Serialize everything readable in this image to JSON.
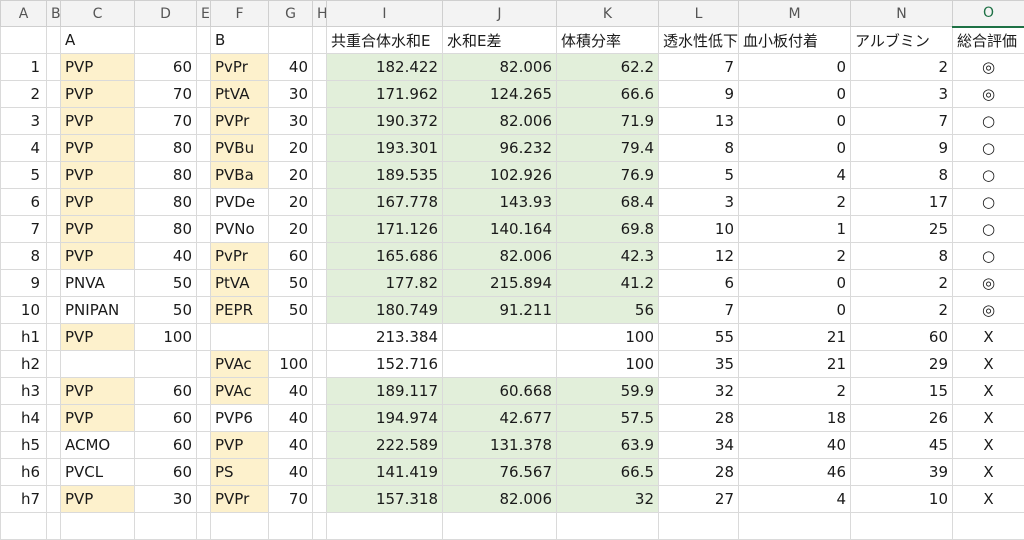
{
  "columns": [
    "A",
    "B",
    "C",
    "D",
    "E",
    "F",
    "G",
    "H",
    "I",
    "J",
    "K",
    "L",
    "M",
    "N",
    "O"
  ],
  "header": {
    "c": "A",
    "f": "B",
    "i": "共重合体水和E",
    "j": "水和E差",
    "k": "体積分率",
    "l": "透水性低下",
    "m": "血小板付着",
    "n": "アルブミン",
    "o": "総合評価"
  },
  "rows": [
    {
      "a": "1",
      "c": "PVP",
      "cy": true,
      "d": "60",
      "f": "PvPr",
      "fy": true,
      "g": "40",
      "i": "182.422",
      "j": "82.006",
      "k": "62.2",
      "gr": true,
      "l": "7",
      "m": "0",
      "n": "2",
      "o": "◎"
    },
    {
      "a": "2",
      "c": "PVP",
      "cy": true,
      "d": "70",
      "f": "PtVA",
      "fy": true,
      "g": "30",
      "i": "171.962",
      "j": "124.265",
      "k": "66.6",
      "gr": true,
      "l": "9",
      "m": "0",
      "n": "3",
      "o": "◎"
    },
    {
      "a": "3",
      "c": "PVP",
      "cy": true,
      "d": "70",
      "f": "PVPr",
      "fy": true,
      "g": "30",
      "i": "190.372",
      "j": "82.006",
      "k": "71.9",
      "gr": true,
      "l": "13",
      "m": "0",
      "n": "7",
      "o": "○"
    },
    {
      "a": "4",
      "c": "PVP",
      "cy": true,
      "d": "80",
      "f": "PVBu",
      "fy": true,
      "g": "20",
      "i": "193.301",
      "j": "96.232",
      "k": "79.4",
      "gr": true,
      "l": "8",
      "m": "0",
      "n": "9",
      "o": "○"
    },
    {
      "a": "5",
      "c": "PVP",
      "cy": true,
      "d": "80",
      "f": "PVBa",
      "fy": true,
      "g": "20",
      "i": "189.535",
      "j": "102.926",
      "k": "76.9",
      "gr": true,
      "l": "5",
      "m": "4",
      "n": "8",
      "o": "○"
    },
    {
      "a": "6",
      "c": "PVP",
      "cy": true,
      "d": "80",
      "f": "PVDe",
      "fy": false,
      "g": "20",
      "i": "167.778",
      "j": "143.93",
      "k": "68.4",
      "gr": true,
      "l": "3",
      "m": "2",
      "n": "17",
      "o": "○"
    },
    {
      "a": "7",
      "c": "PVP",
      "cy": true,
      "d": "80",
      "f": "PVNo",
      "fy": false,
      "g": "20",
      "i": "171.126",
      "j": "140.164",
      "k": "69.8",
      "gr": true,
      "l": "10",
      "m": "1",
      "n": "25",
      "o": "○"
    },
    {
      "a": "8",
      "c": "PVP",
      "cy": true,
      "d": "40",
      "f": "PvPr",
      "fy": true,
      "g": "60",
      "i": "165.686",
      "j": "82.006",
      "k": "42.3",
      "gr": true,
      "l": "12",
      "m": "2",
      "n": "8",
      "o": "○"
    },
    {
      "a": "9",
      "c": "PNVA",
      "cy": false,
      "d": "50",
      "f": "PtVA",
      "fy": true,
      "g": "50",
      "i": "177.82",
      "j": "215.894",
      "k": "41.2",
      "gr": true,
      "l": "6",
      "m": "0",
      "n": "2",
      "o": "◎"
    },
    {
      "a": "10",
      "c": "PNIPAN",
      "cy": false,
      "d": "50",
      "f": "PEPR",
      "fy": true,
      "g": "50",
      "i": "180.749",
      "j": "91.211",
      "k": "56",
      "gr": true,
      "l": "7",
      "m": "0",
      "n": "2",
      "o": "◎"
    },
    {
      "a": "h1",
      "c": "PVP",
      "cy": true,
      "d": "100",
      "f": "",
      "fy": false,
      "g": "",
      "i": "213.384",
      "j": "",
      "k": "100",
      "gr": false,
      "l": "55",
      "m": "21",
      "n": "60",
      "o": "X"
    },
    {
      "a": "h2",
      "c": "",
      "cy": false,
      "d": "",
      "f": "PVAc",
      "fy": true,
      "g": "100",
      "i": "152.716",
      "j": "",
      "k": "100",
      "gr": false,
      "l": "35",
      "m": "21",
      "n": "29",
      "o": "X"
    },
    {
      "a": "h3",
      "c": "PVP",
      "cy": true,
      "d": "60",
      "f": "PVAc",
      "fy": true,
      "g": "40",
      "i": "189.117",
      "j": "60.668",
      "k": "59.9",
      "gr": true,
      "l": "32",
      "m": "2",
      "n": "15",
      "o": "X"
    },
    {
      "a": "h4",
      "c": "PVP",
      "cy": true,
      "d": "60",
      "f": "PVP6",
      "fy": false,
      "g": "40",
      "i": "194.974",
      "j": "42.677",
      "k": "57.5",
      "gr": true,
      "l": "28",
      "m": "18",
      "n": "26",
      "o": "X"
    },
    {
      "a": "h5",
      "c": "ACMO",
      "cy": false,
      "d": "60",
      "f": "PVP",
      "fy": true,
      "g": "40",
      "i": "222.589",
      "j": "131.378",
      "k": "63.9",
      "gr": true,
      "l": "34",
      "m": "40",
      "n": "45",
      "o": "X"
    },
    {
      "a": "h6",
      "c": "PVCL",
      "cy": false,
      "d": "60",
      "f": "PS",
      "fy": true,
      "g": "40",
      "i": "141.419",
      "j": "76.567",
      "k": "66.5",
      "gr": true,
      "l": "28",
      "m": "46",
      "n": "39",
      "o": "X"
    },
    {
      "a": "h7",
      "c": "PVP",
      "cy": true,
      "d": "30",
      "f": "PVPr",
      "fy": true,
      "g": "70",
      "i": "157.318",
      "j": "82.006",
      "k": "32",
      "gr": true,
      "l": "27",
      "m": "4",
      "n": "10",
      "o": "X"
    }
  ],
  "colors": {
    "yellow": "#fdf1cc",
    "green": "#e2efda",
    "selected_col": "#1e7145"
  }
}
